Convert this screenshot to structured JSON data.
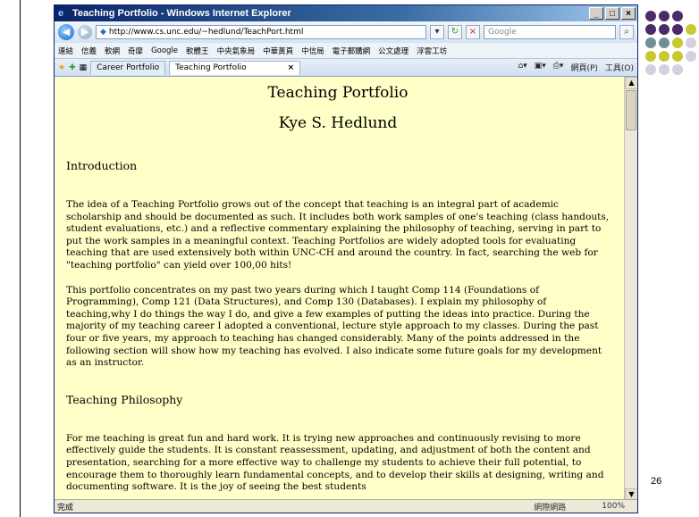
{
  "window": {
    "title": "Teaching Portfolio - Windows Internet Explorer"
  },
  "addressbar": {
    "url": "http://www.cs.unc.edu/~hedlund/TeachPort.html",
    "search_placeholder": "Google"
  },
  "links": [
    "連結",
    "信義",
    "軟網",
    "奇摩",
    "Google",
    "軟體王",
    "中央氣象局",
    "中華黃頁",
    "中信局",
    "電子郵購網",
    "公文處理",
    "浮雲工坊"
  ],
  "tabs": [
    {
      "label": "Career Portfolio"
    },
    {
      "label": "Teaching Portfolio"
    }
  ],
  "toolbar": {
    "page": "網頁(P)",
    "tools": "工具(O)"
  },
  "page": {
    "title": "Teaching Portfolio",
    "author": "Kye S. Hedlund",
    "intro_heading": "Introduction",
    "intro_p1": "The idea of a Teaching Portfolio grows out of the concept that teaching is an integral part of academic scholarship and should be documented as such. It includes both work samples of one's teaching (class handouts, student evaluations, etc.) and a reflective commentary explaining the philosophy of teaching, serving in part to put the work samples in a meaningful context. Teaching Portfolios are widely adopted tools for evaluating teaching that are used extensively both within UNC-CH and around the country. In fact, searching the web for \"teaching portfolio\" can yield over 100,00 hits!",
    "intro_p2": "This portfolio concentrates on my past two years during which I taught Comp 114 (Foundations of Programming), Comp 121 (Data Structures), and Comp 130 (Databases). I explain my philosophy of teaching,why I do things the way I do, and give a few examples of putting the ideas into practice. During the majority of my teaching career I adopted a conventional, lecture style approach to my classes. During the past four or five years, my approach to teaching has changed considerably. Many of the points addressed in the following section will show how my teaching has evolved. I also indicate some future goals for my development as an instructor.",
    "phil_heading": "Teaching Philosophy",
    "phil_p1": "For me teaching is great fun and hard work. It is trying new approaches and continuously revising to more effectively guide the students. It is constant reassessment, updating, and adjustment of both the content and presentation, searching for a more effective way to challenge my students to achieve their full potential, to encourage them to thoroughly learn fundamental concepts, and to develop their skills at designing, writing and documenting software. It is the joy of seeing the best students"
  },
  "status": {
    "left": "完成",
    "zone": "網際網路",
    "zoom": "100%"
  },
  "slide": {
    "page_number": "26"
  },
  "colors": {
    "dots": [
      "#4b2a6b",
      "#6f8f94",
      "#c8c832",
      "#d4d0e0"
    ]
  }
}
